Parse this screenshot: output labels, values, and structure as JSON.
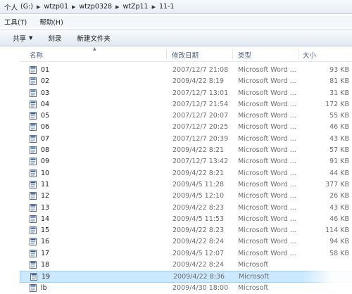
{
  "breadcrumb": [
    "个人",
    "(G:)",
    "wtzp01",
    "wtzp0328",
    "wtZp11",
    "11-1"
  ],
  "menu": {
    "tools": "工具(T)",
    "help": "帮助(H)"
  },
  "toolbar": {
    "share": "共享",
    "burn": "刻录",
    "new_folder": "新建文件夹"
  },
  "columns": {
    "name": "名称",
    "date": "修改日期",
    "type": "类型",
    "size": "大小"
  },
  "files": [
    {
      "name": "01",
      "date": "2007/12/7 21:08",
      "type": "Microsoft Word ...",
      "size": "93 KB"
    },
    {
      "name": "02",
      "date": "2009/4/22 8:19",
      "type": "Microsoft Word ...",
      "size": "81 KB"
    },
    {
      "name": "03",
      "date": "2007/12/7 13:01",
      "type": "Microsoft Word ...",
      "size": "31 KB"
    },
    {
      "name": "04",
      "date": "2007/12/7 21:54",
      "type": "Microsoft Word ...",
      "size": "172 KB"
    },
    {
      "name": "05",
      "date": "2007/12/7 20:07",
      "type": "Microsoft Word ...",
      "size": "55 KB"
    },
    {
      "name": "06",
      "date": "2007/12/7 20:25",
      "type": "Microsoft Word ...",
      "size": "46 KB"
    },
    {
      "name": "07",
      "date": "2007/12/7 20:39",
      "type": "Microsoft Word ...",
      "size": "43 KB"
    },
    {
      "name": "08",
      "date": "2009/4/22 8:21",
      "type": "Microsoft Word ...",
      "size": "57 KB"
    },
    {
      "name": "09",
      "date": "2007/12/7 13:42",
      "type": "Microsoft Word ...",
      "size": "91 KB"
    },
    {
      "name": "10",
      "date": "2009/4/22 8:21",
      "type": "Microsoft Word ...",
      "size": "44 KB"
    },
    {
      "name": "11",
      "date": "2009/4/5 11:28",
      "type": "Microsoft Word ...",
      "size": "377 KB"
    },
    {
      "name": "12",
      "date": "2009/4/5 12:10",
      "type": "Microsoft Word ...",
      "size": "26 KB"
    },
    {
      "name": "13",
      "date": "2009/4/22 8:23",
      "type": "Microsoft Word ...",
      "size": "43 KB"
    },
    {
      "name": "14",
      "date": "2009/4/5 11:53",
      "type": "Microsoft Word ...",
      "size": "46 KB"
    },
    {
      "name": "15",
      "date": "2009/4/22 8:23",
      "type": "Microsoft Word ...",
      "size": "114 KB"
    },
    {
      "name": "16",
      "date": "2009/4/22 8:24",
      "type": "Microsoft Word ...",
      "size": "94 KB"
    },
    {
      "name": "17",
      "date": "2009/4/5 12:07",
      "type": "Microsoft Word ...",
      "size": "58 KB"
    },
    {
      "name": "18",
      "date": "2009/4/22 8:24",
      "type": "Microsoft",
      "size": ""
    },
    {
      "name": "19",
      "date": "2009/4/22 8:36",
      "type": "Microsoft",
      "size": ""
    },
    {
      "name": "lb",
      "date": "2009/4/30 18:00",
      "type": "Microsoft",
      "size": ""
    }
  ],
  "selected_row": 18,
  "icons": {
    "file": "word-document-icon",
    "share_menu": "chevron-down-icon"
  },
  "colors": {
    "selection": "#cce8ff",
    "header_text": "#4c607a",
    "meta_text": "#6d6d6d"
  }
}
